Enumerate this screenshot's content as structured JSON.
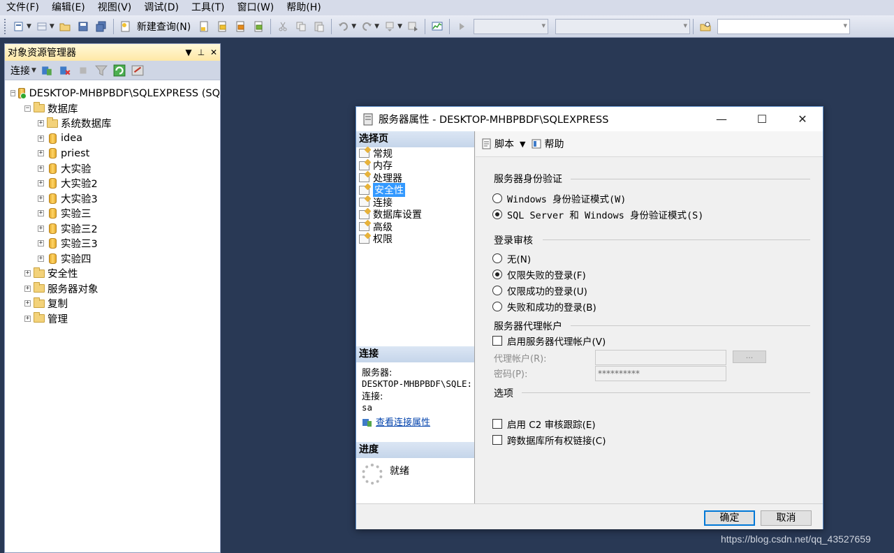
{
  "menubar": {
    "items": [
      "文件(F)",
      "编辑(E)",
      "视图(V)",
      "调试(D)",
      "工具(T)",
      "窗口(W)",
      "帮助(H)"
    ]
  },
  "toolbar": {
    "new_query_label": "新建查询(N)"
  },
  "explorer": {
    "title": "对象资源管理器",
    "connect_label": "连接",
    "tree": {
      "server": "DESKTOP-MHBPBDF\\SQLEXPRESS (SQ",
      "databases_folder": "数据库",
      "system_databases": "系统数据库",
      "databases": [
        "idea",
        "priest",
        "大实验",
        "大实验2",
        "大实验3",
        "实验三",
        "实验三2",
        "实验三3",
        "实验四"
      ],
      "folders": [
        "安全性",
        "服务器对象",
        "复制",
        "管理"
      ]
    }
  },
  "dialog": {
    "title": "服务器属性 - DESKTOP-MHBPBDF\\SQLEXPRESS",
    "select_page_header": "选择页",
    "pages": [
      "常规",
      "内存",
      "处理器",
      "安全性",
      "连接",
      "数据库设置",
      "高级",
      "权限"
    ],
    "selected_page": "安全性",
    "connection_header": "连接",
    "server_label": "服务器:",
    "server_value": "DESKTOP-MHBPBDF\\SQLE:",
    "connection_label": "连接:",
    "connection_value": "sa",
    "view_connection_link": "查看连接属性",
    "progress_header": "进度",
    "progress_status": "就绪",
    "script_label": "脚本",
    "help_label": "帮助",
    "auth_group": "服务器身份验证",
    "auth_windows": "Windows 身份验证模式(W)",
    "auth_mixed": "SQL Server 和 Windows 身份验证模式(S)",
    "audit_group": "登录审核",
    "audit_none": "无(N)",
    "audit_failed": "仅限失败的登录(F)",
    "audit_success": "仅限成功的登录(U)",
    "audit_both": "失败和成功的登录(B)",
    "proxy_group": "服务器代理帐户",
    "proxy_enable": "启用服务器代理帐户(V)",
    "proxy_account_label": "代理帐户(R):",
    "proxy_password_label": "密码(P):",
    "proxy_password_value": "**********",
    "proxy_browse": "...",
    "options_group": "选项",
    "c2_audit": "启用 C2 审核跟踪(E)",
    "cross_db": "跨数据库所有权链接(C)",
    "ok_label": "确定",
    "cancel_label": "取消"
  },
  "watermark": "https://blog.csdn.net/qq_43527659"
}
